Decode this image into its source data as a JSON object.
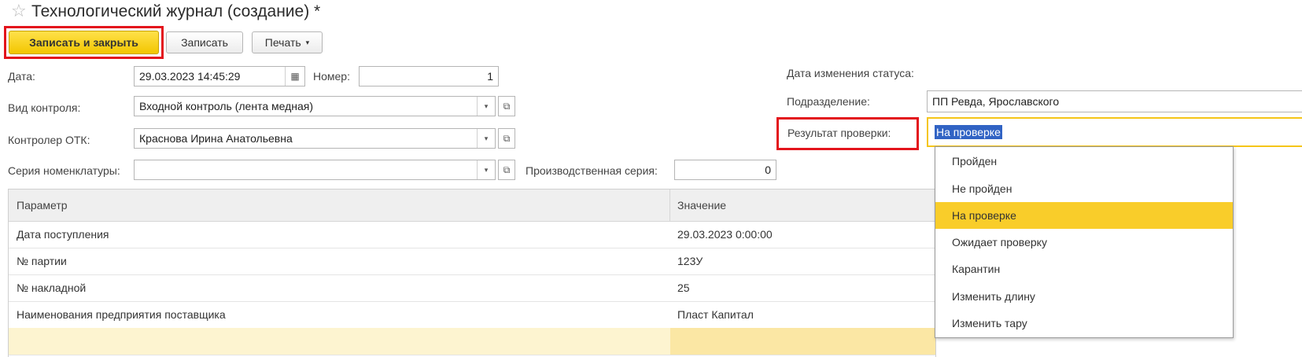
{
  "header": {
    "title": "Технологический журнал (создание) *"
  },
  "toolbar": {
    "save_close_label": "Записать и закрыть",
    "save_label": "Записать",
    "print_label": "Печать"
  },
  "form": {
    "date_label": "Дата:",
    "date_value": "29.03.2023 14:45:29",
    "number_label": "Номер:",
    "number_value": "1",
    "control_type_label": "Вид контроля:",
    "control_type_value": "Входной контроль (лента медная)",
    "inspector_label": "Контролер ОТК:",
    "inspector_value": "Краснова Ирина Анатольевна",
    "series_label": "Серия номенклатуры:",
    "series_value": "",
    "prod_series_label": "Производственная серия:",
    "prod_series_value": "0",
    "status_date_label": "Дата изменения статуса:",
    "division_label": "Подразделение:",
    "division_value": "ПП Ревда, Ярославского",
    "result_label": "Результат проверки:",
    "result_value": "На проверке"
  },
  "table": {
    "columns": [
      "Параметр",
      "Значение"
    ],
    "rows": [
      {
        "param": "Дата поступления",
        "value": "29.03.2023 0:00:00"
      },
      {
        "param": "№ партии",
        "value": "123У"
      },
      {
        "param": "№ накладной",
        "value": "25"
      },
      {
        "param": "Наименования предприятия поставщика",
        "value": "Пласт Капитал"
      }
    ]
  },
  "dropdown": {
    "options": [
      "Пройден",
      "Не пройден",
      "На проверке",
      "Ожидает проверку",
      "Карантин",
      "Изменить длину",
      "Изменить тару"
    ],
    "selected_index": 2
  },
  "icons": {
    "favorite": "star-icon",
    "calendar": "calendar-icon",
    "dropdown": "chevron-down-icon",
    "open": "open-form-icon"
  },
  "colors": {
    "primary_button": "#f5c800",
    "highlight_frame": "#e3141c",
    "selected_option": "#f9cd2a",
    "text_selection": "#3163c4"
  }
}
